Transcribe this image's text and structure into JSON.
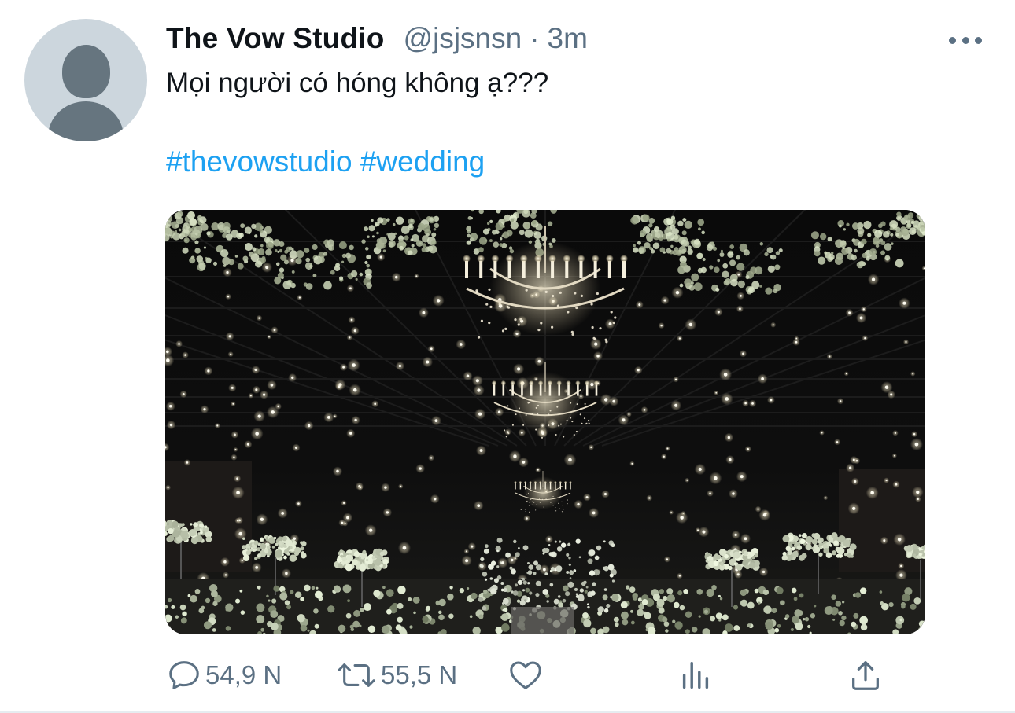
{
  "tweet": {
    "author": {
      "display_name": "The Vow Studio",
      "handle": "@jsjsnsn",
      "separator": "·",
      "time": "3m"
    },
    "text": "Mọi người có hóng không ạ???",
    "hashtags": [
      "#thevowstudio",
      "#wedding"
    ],
    "media_description_icon": "image",
    "actions": {
      "reply_count": "54,9 N",
      "retweet_count": "55,5 N"
    }
  },
  "icons": {
    "more": "more-horizontal-icon",
    "reply": "reply-icon",
    "retweet": "retweet-icon",
    "like": "heart-icon",
    "analytics": "analytics-icon",
    "share": "share-icon"
  },
  "colors": {
    "link": "#1da1f2",
    "secondary_text": "#5b7083",
    "primary_text": "#0f1419",
    "avatar_bg": "#ccd6dd",
    "avatar_fg": "#66757f"
  }
}
